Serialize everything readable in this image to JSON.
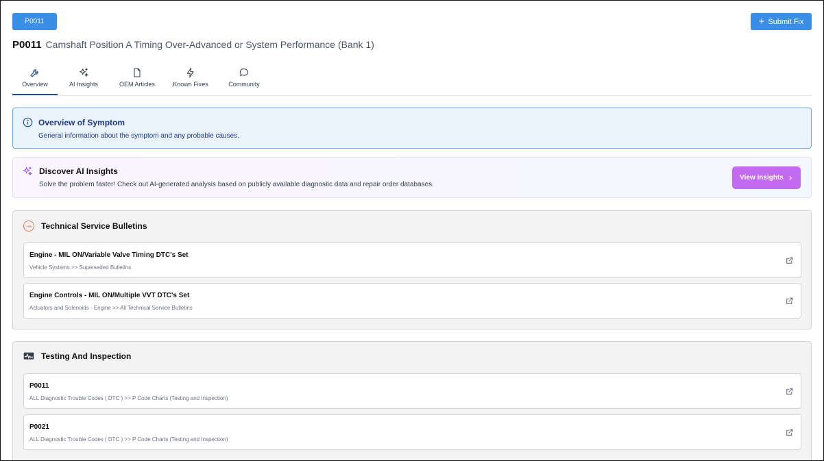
{
  "header": {
    "code_chip": "P0011",
    "submit_label": "Submit Fix",
    "title_code": "P0011",
    "title_desc": "Camshaft Position A Timing Over-Advanced or System Performance (Bank 1)"
  },
  "tabs": [
    {
      "label": "Overview",
      "icon": "wrench-icon",
      "active": true
    },
    {
      "label": "AI Insights",
      "icon": "sparkles-icon",
      "active": false
    },
    {
      "label": "OEM Articles",
      "icon": "document-icon",
      "active": false
    },
    {
      "label": "Known Fixes",
      "icon": "lightning-icon",
      "active": false
    },
    {
      "label": "Community",
      "icon": "chat-icon",
      "active": false
    }
  ],
  "overview": {
    "title": "Overview of Symptom",
    "subtitle": "General information about the symptom and any probable causes."
  },
  "ai": {
    "title": "Discover AI Insights",
    "subtitle": "Solve the problem faster! Check out AI-generated analysis based on publicly available diagnostic data and repair order databases.",
    "button": "View insights"
  },
  "tsb": {
    "badge": "TSB",
    "title": "Technical Service Bulletins",
    "items": [
      {
        "title": "Engine - MIL ON/Variable Valve Timing DTC's Set",
        "sub": "Vehicle Systems >> Superseded Bulletins"
      },
      {
        "title": "Engine Controls - MIL ON/Multiple VVT DTC's Set",
        "sub": "Actuators and Solenoids - Engine >> All Technical Service Bulletins"
      }
    ]
  },
  "testing": {
    "title": "Testing And Inspection",
    "items": [
      {
        "title": "P0011",
        "sub": "ALL Diagnostic Trouble Codes ( DTC ) >> P Code Charts (Testing and Inspection)"
      },
      {
        "title": "P0021",
        "sub": "ALL Diagnostic Trouble Codes ( DTC ) >> P Code Charts (Testing and Inspection)"
      }
    ]
  },
  "colors": {
    "primary": "#3b8ee6",
    "active_tab": "#1e4e8c",
    "ai_button": "#c46af0",
    "tsb_badge": "#ef7348"
  }
}
